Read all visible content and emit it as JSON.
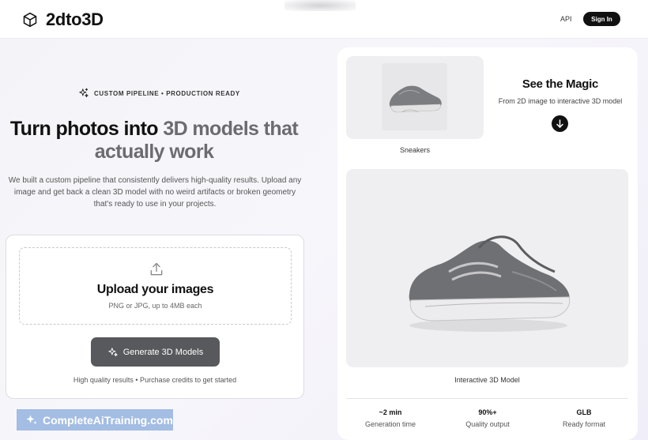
{
  "header": {
    "brand": "2dto3D",
    "api_label": "API",
    "signin_label": "Sign In"
  },
  "hero": {
    "tagline": "CUSTOM PIPELINE • PRODUCTION READY",
    "headline_part1": "Turn photos into ",
    "headline_accent": "3D models that",
    "headline_part2": "actually work",
    "description": "We built a custom pipeline that consistently delivers high-quality results. Upload any image and get back a clean 3D model with no weird artifacts or broken geometry that's ready to use in your projects."
  },
  "upload": {
    "title": "Upload your images",
    "subtitle": "PNG or JPG, up to 4MB each",
    "generate_label": "Generate 3D Models",
    "note": "High quality results • Purchase credits to get started"
  },
  "demo": {
    "thumb_label": "Sneakers",
    "magic_title": "See the Magic",
    "magic_subtitle": "From 2D image to interactive 3D model",
    "viewer_label": "Interactive 3D Model",
    "stats": [
      {
        "value": "~2 min",
        "label": "Generation time"
      },
      {
        "value": "90%+",
        "label": "Quality output"
      },
      {
        "value": "GLB",
        "label": "Ready format"
      }
    ]
  },
  "watermark": {
    "text": "CompleteAiTraining.com"
  },
  "icons": [
    "cube-icon",
    "sparkles-icon",
    "upload-icon",
    "arrow-down-icon"
  ]
}
